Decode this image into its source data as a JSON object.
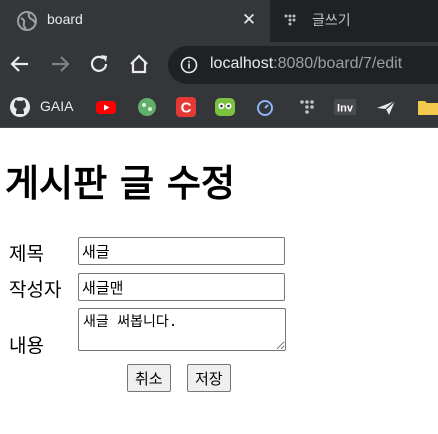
{
  "browser": {
    "tabs": [
      {
        "title": "board",
        "icon": "globe-icon",
        "active": true
      },
      {
        "title": "글쓰기",
        "icon": "dots-icon",
        "active": false
      }
    ],
    "close_label": "✕",
    "address": {
      "host": "localhost",
      "path": ":8080/board/7/edit"
    },
    "bookmarks": [
      {
        "label": "GAIA",
        "icon": "github-icon"
      },
      {
        "label": "",
        "icon": "youtube-icon"
      },
      {
        "label": "",
        "icon": "green-circle-icon"
      },
      {
        "label": "",
        "icon": "c-logo-icon"
      },
      {
        "label": "",
        "icon": "owl-icon"
      },
      {
        "label": "",
        "icon": "timer-icon"
      },
      {
        "label": "",
        "icon": "dots-icon"
      },
      {
        "label": "",
        "icon": "inv-icon"
      },
      {
        "label": "",
        "icon": "plane-icon"
      },
      {
        "label": "",
        "icon": "folder-icon"
      }
    ],
    "inv_text": "Inv"
  },
  "page": {
    "title": "게시판 글 수정",
    "form": {
      "title_label": "제목",
      "title_value": "새글",
      "author_label": "작성자",
      "author_value": "새글맨",
      "content_label": "내용",
      "content_value": "새글 써봅니다.",
      "cancel_label": "취소",
      "save_label": "저장"
    }
  },
  "colors": {
    "chrome_dark": "#202124",
    "chrome_tab": "#35363a",
    "youtube_red": "#ff0000",
    "c_red": "#e53935",
    "owl_green": "#7cc242"
  }
}
